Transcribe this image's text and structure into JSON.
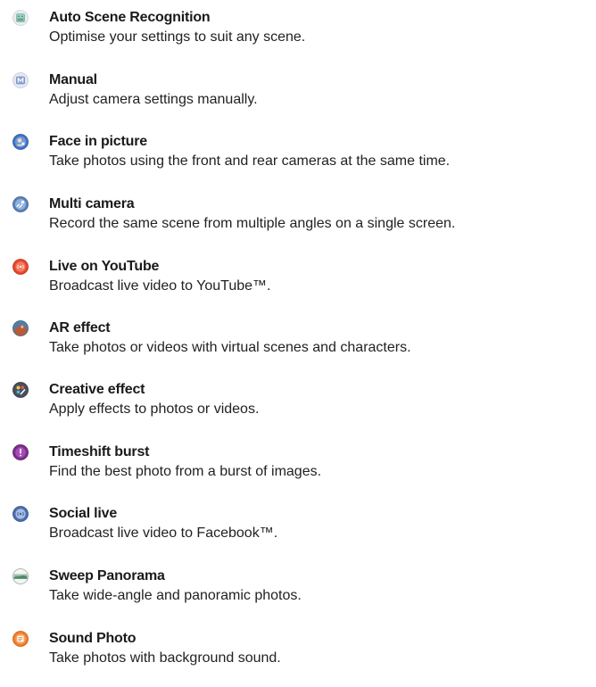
{
  "modes": [
    {
      "title": "Auto Scene Recognition",
      "description": "Optimise your settings to suit any scene.",
      "icon": "scene-recognition-icon"
    },
    {
      "title": "Manual",
      "description": "Adjust camera settings manually.",
      "icon": "manual-mode-icon"
    },
    {
      "title": "Face in picture",
      "description": "Take photos using the front and rear cameras at the same time.",
      "icon": "face-in-picture-icon"
    },
    {
      "title": "Multi camera",
      "description": "Record the same scene from multiple angles on a single screen.",
      "icon": "multi-camera-icon"
    },
    {
      "title": "Live on YouTube",
      "description": "Broadcast live video to YouTube™.",
      "icon": "live-youtube-icon"
    },
    {
      "title": "AR effect",
      "description": "Take photos or videos with virtual scenes and characters.",
      "icon": "ar-effect-icon"
    },
    {
      "title": "Creative effect",
      "description": "Apply effects to photos or videos.",
      "icon": "creative-effect-icon"
    },
    {
      "title": "Timeshift burst",
      "description": "Find the best photo from a burst of images.",
      "icon": "timeshift-burst-icon"
    },
    {
      "title": "Social live",
      "description": "Broadcast live video to Facebook™.",
      "icon": "social-live-icon"
    },
    {
      "title": "Sweep Panorama",
      "description": "Take wide-angle and panoramic photos.",
      "icon": "sweep-panorama-icon"
    },
    {
      "title": "Sound Photo",
      "description": "Take photos with background sound.",
      "icon": "sound-photo-icon"
    }
  ]
}
